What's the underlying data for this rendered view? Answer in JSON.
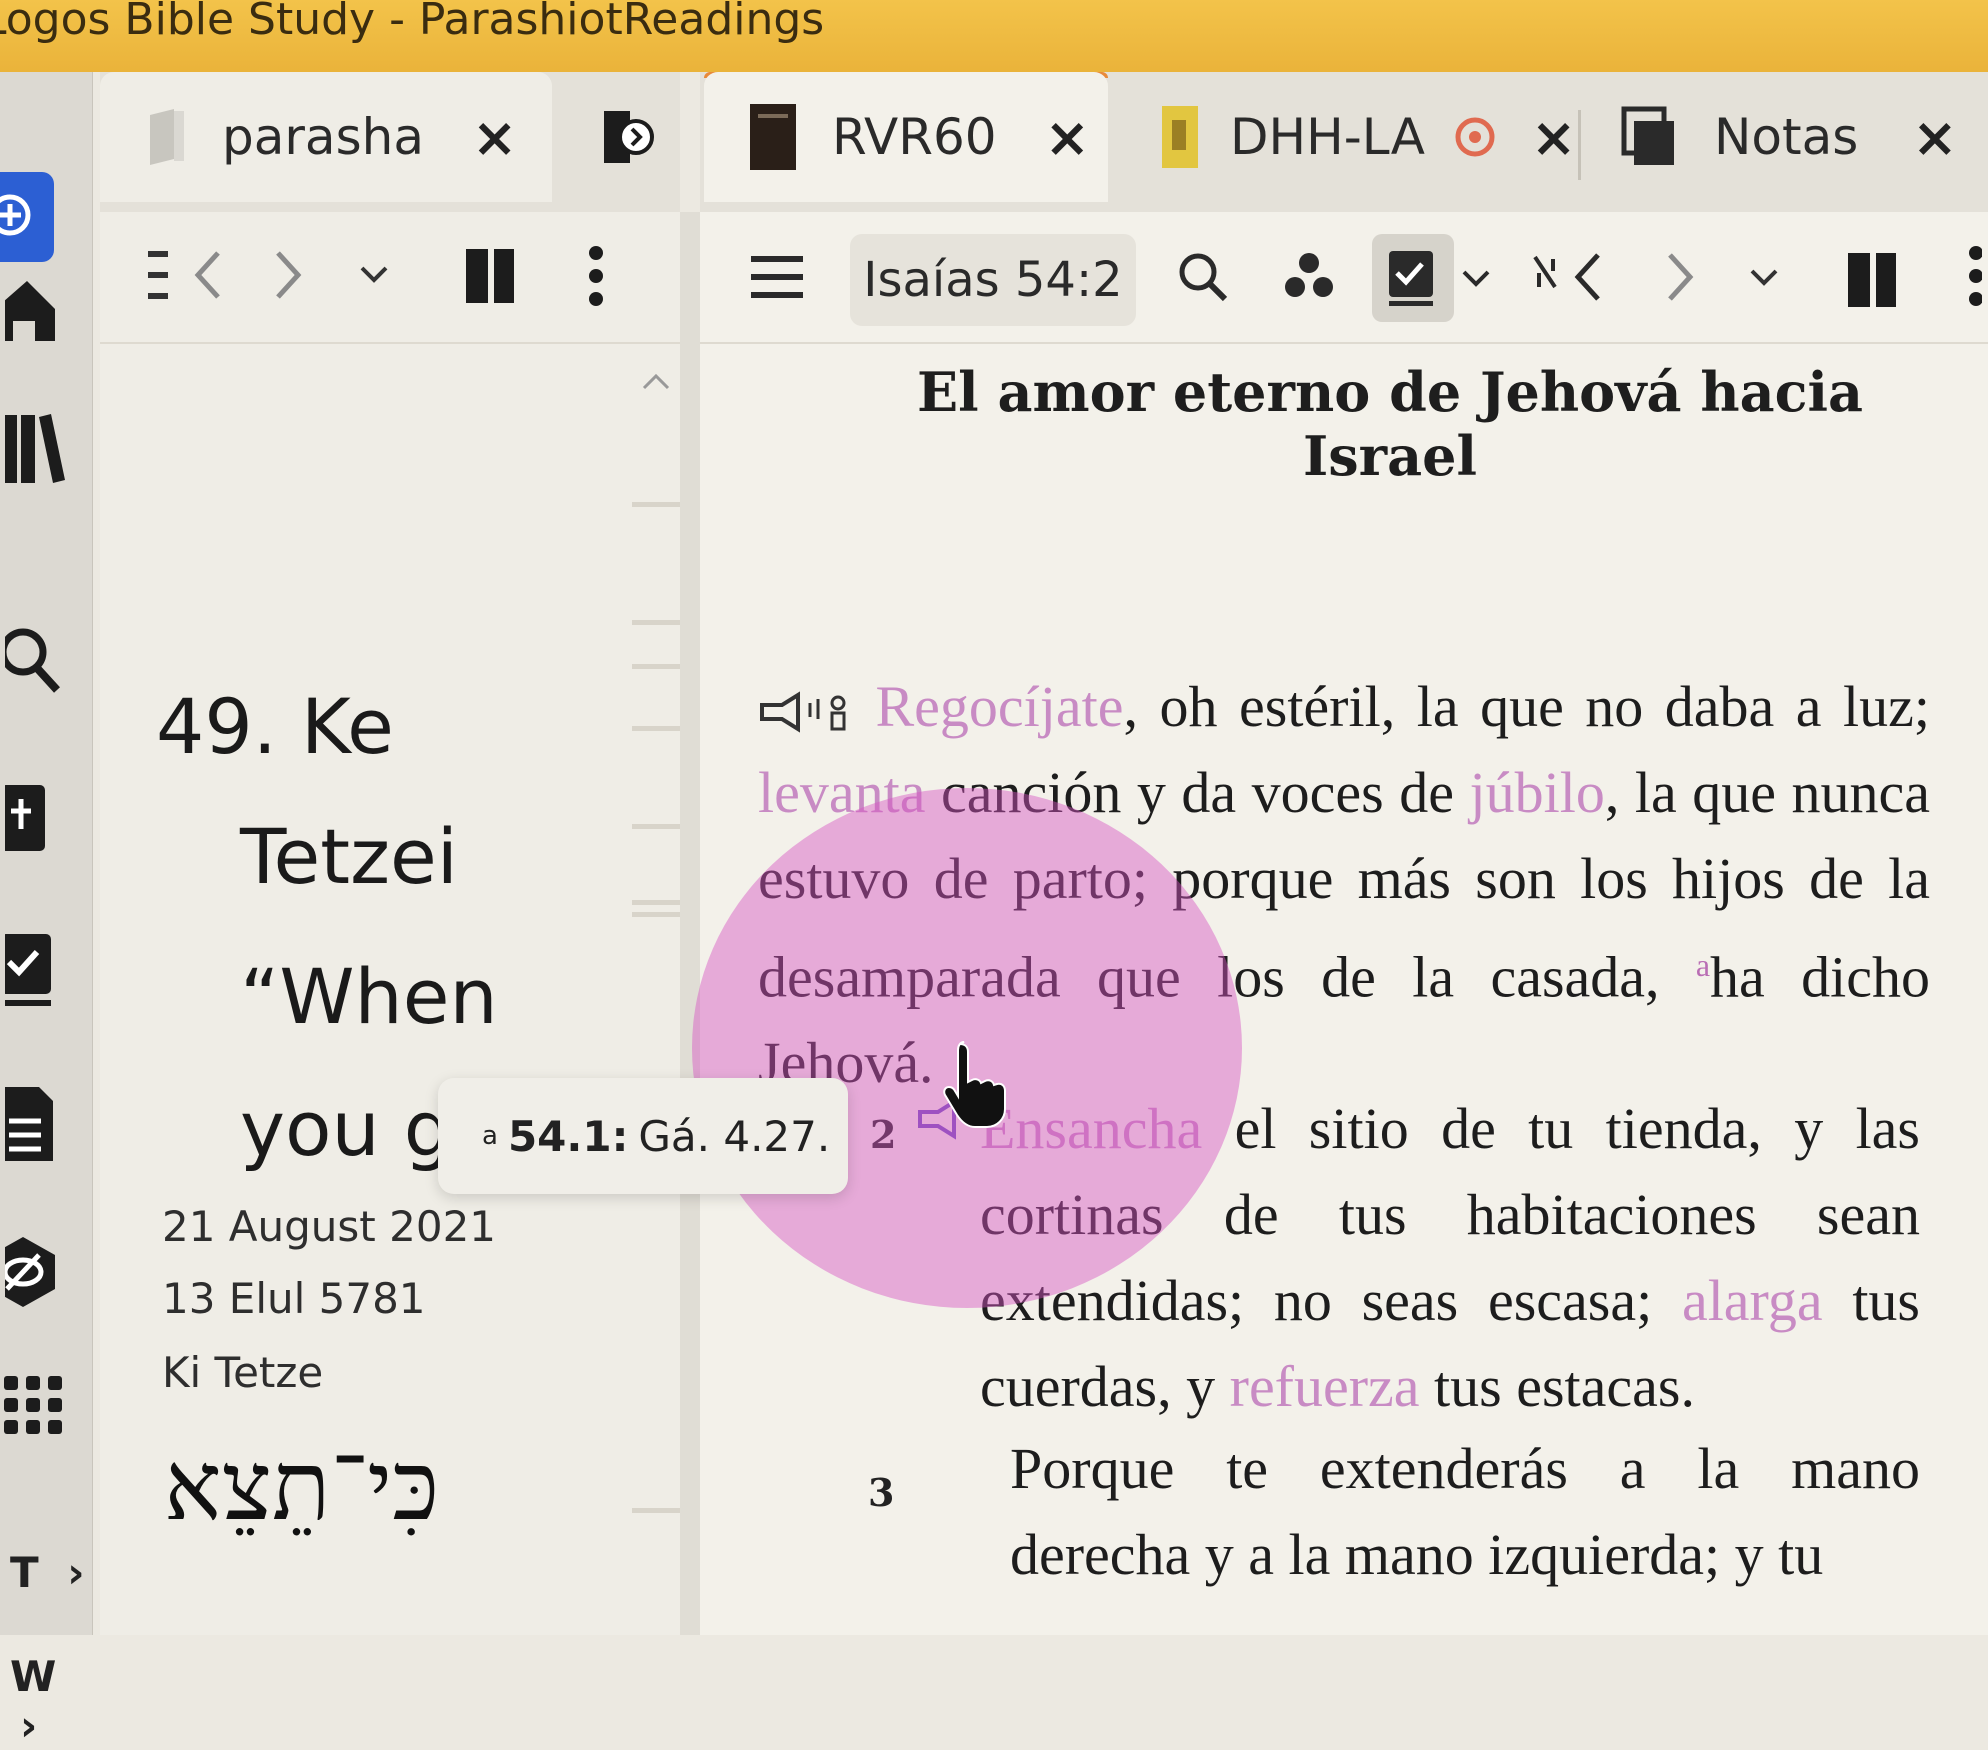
{
  "app": {
    "title": "Logos Bible Study - ParashiotReadings"
  },
  "sidebar_nav": {
    "labels": [
      {
        "letter": "T",
        "arrow": "›"
      },
      {
        "letter": "W",
        "arrow": "›"
      }
    ]
  },
  "left_panel": {
    "tab_label": "parasha",
    "close_glyph": "×",
    "title_lines": [
      "49. Ke",
      "Tetzei",
      "“When",
      "you g"
    ],
    "date_gregorian": "21 August 2021",
    "date_hebrew": "13 Elul 5781",
    "parasha_name": "Ki Tetze",
    "hebrew_title": "כִּי־תֵצֵא"
  },
  "right_panel": {
    "tabs": [
      {
        "label": "RVR60",
        "close": "×"
      },
      {
        "label": "DHH-LA",
        "close": "×"
      },
      {
        "label": "Notas",
        "close": "×"
      }
    ],
    "reference": "Isaías 54:2",
    "heading": "El amor eterno de Jehová hacia Israel",
    "verse1": {
      "w1": "Regocíjate",
      "t1": ", oh estéril, la que no daba a luz; ",
      "w2": "levanta",
      "t2": " canción y da voces de ",
      "w3": "júbilo",
      "t3": ", la que nunca estuvo de parto; porque más son los hijos de la desamparada que los de la casada, ",
      "fn": "a",
      "t4": "ha dicho Jehová."
    },
    "verse2": {
      "num": "2",
      "w1": "Ensancha",
      "t1": " el sitio de tu tienda, y las cortinas de tus habitaciones sean extendidas; no seas escasa; ",
      "w2": "alarga",
      "t2": " tus cuerdas, y ",
      "w3": "refuerza",
      "t3": " tus estacas."
    },
    "verse3": {
      "num": "3",
      "text": "Porque te extenderás a la mano derecha y a la mano izquierda; y tu"
    }
  },
  "tooltip": {
    "marker": "a",
    "ref": "54.1:",
    "text": "Gá. 4.27."
  },
  "colors": {
    "titlebar": "#eab33a",
    "highlight": "#c88bc4",
    "accent_blue": "#2c5fd3",
    "pink_overlay": "#d654c4"
  }
}
